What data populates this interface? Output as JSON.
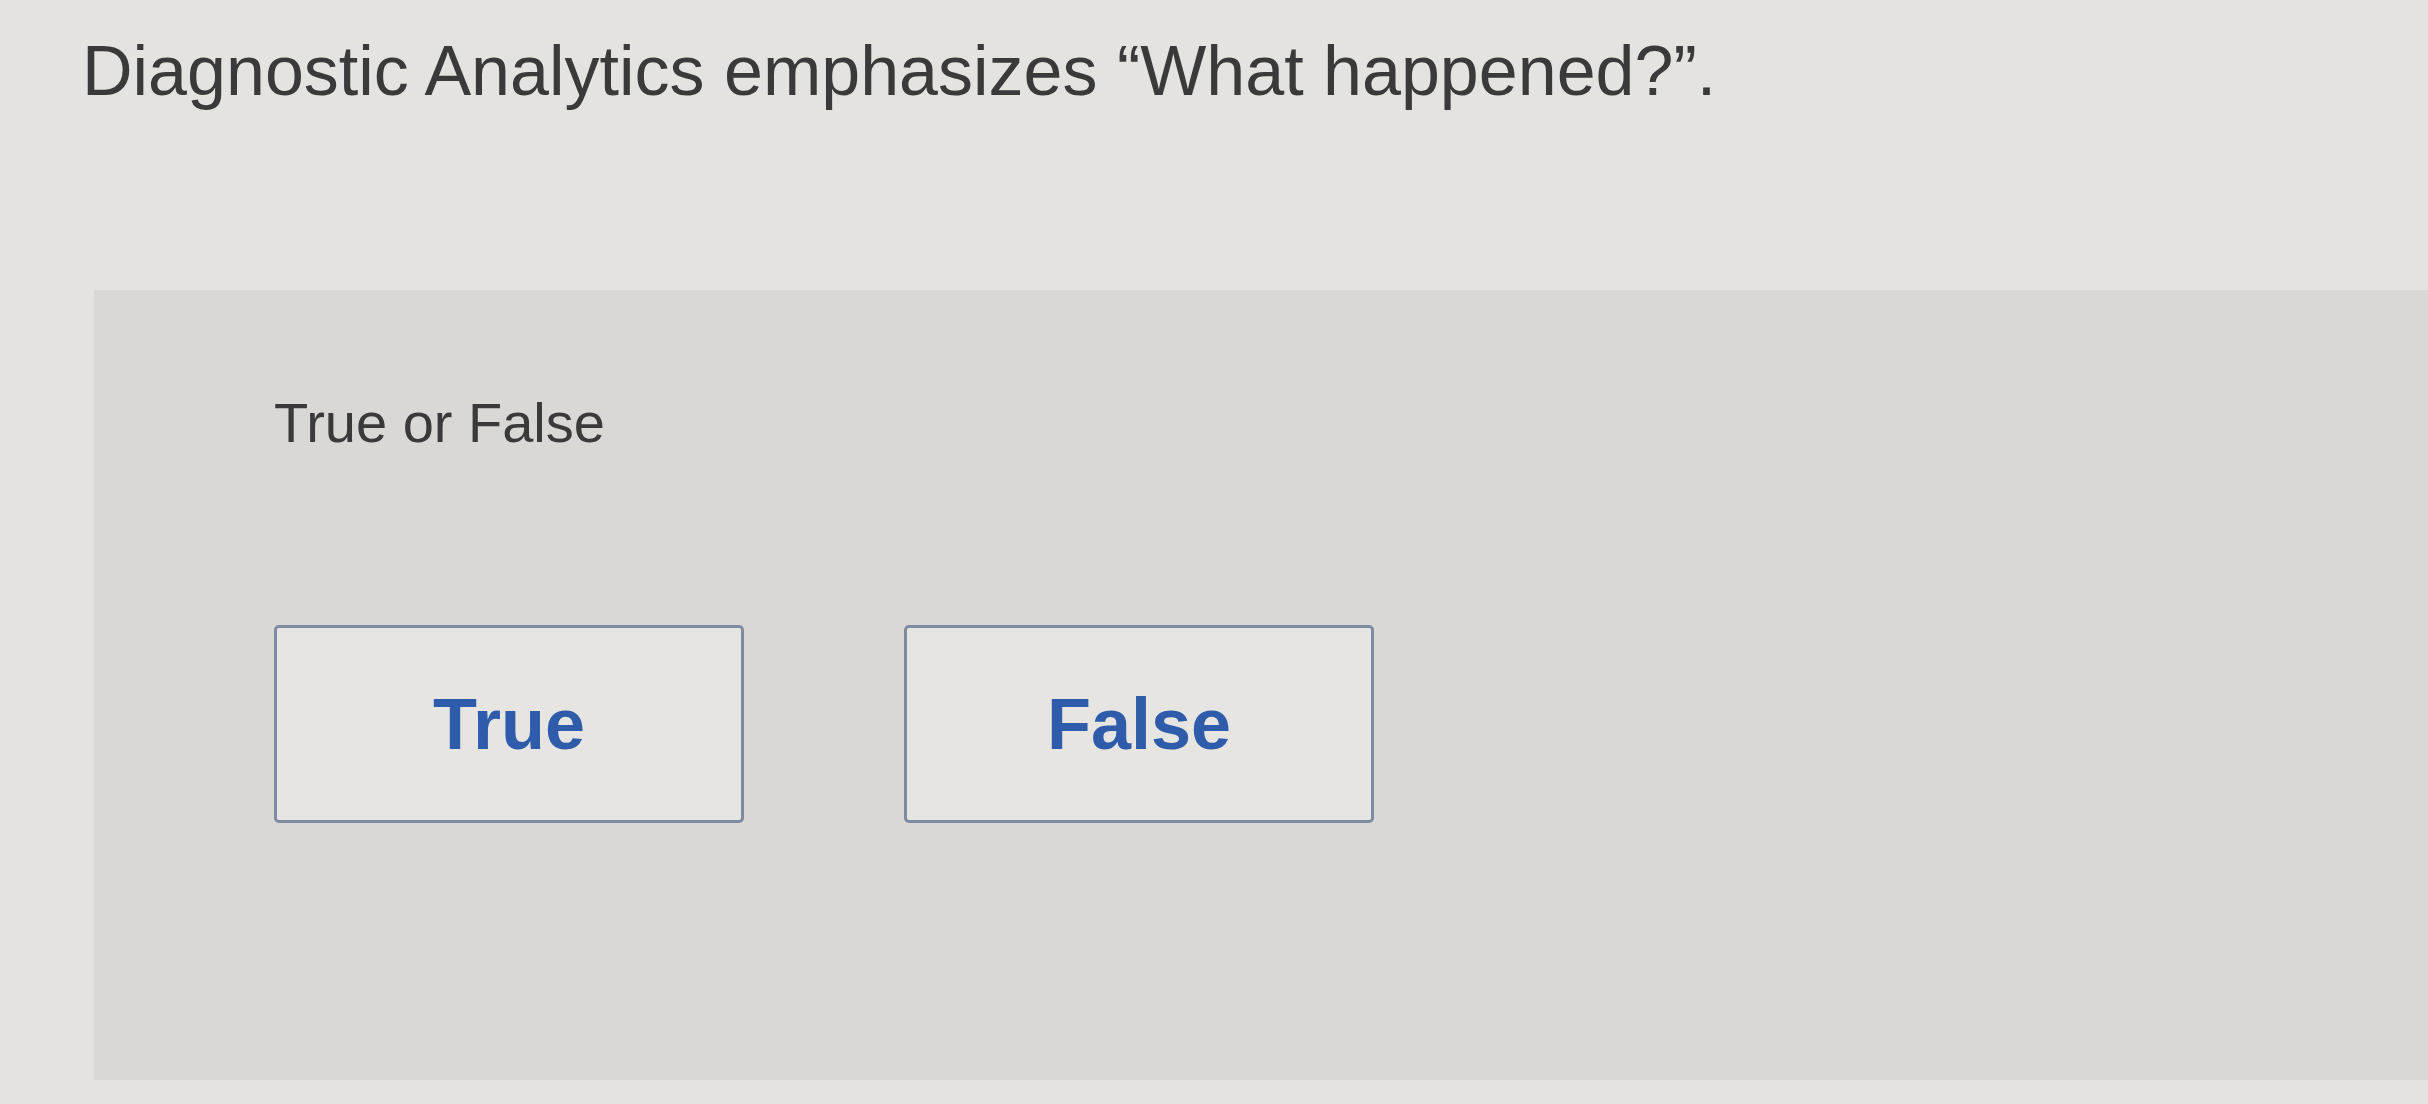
{
  "question": {
    "text": "Diagnostic Analytics emphasizes “What happened?”."
  },
  "answer_panel": {
    "instruction": "True or False",
    "options": [
      {
        "label": "True",
        "selected": false
      },
      {
        "label": "False",
        "selected": false
      }
    ]
  }
}
